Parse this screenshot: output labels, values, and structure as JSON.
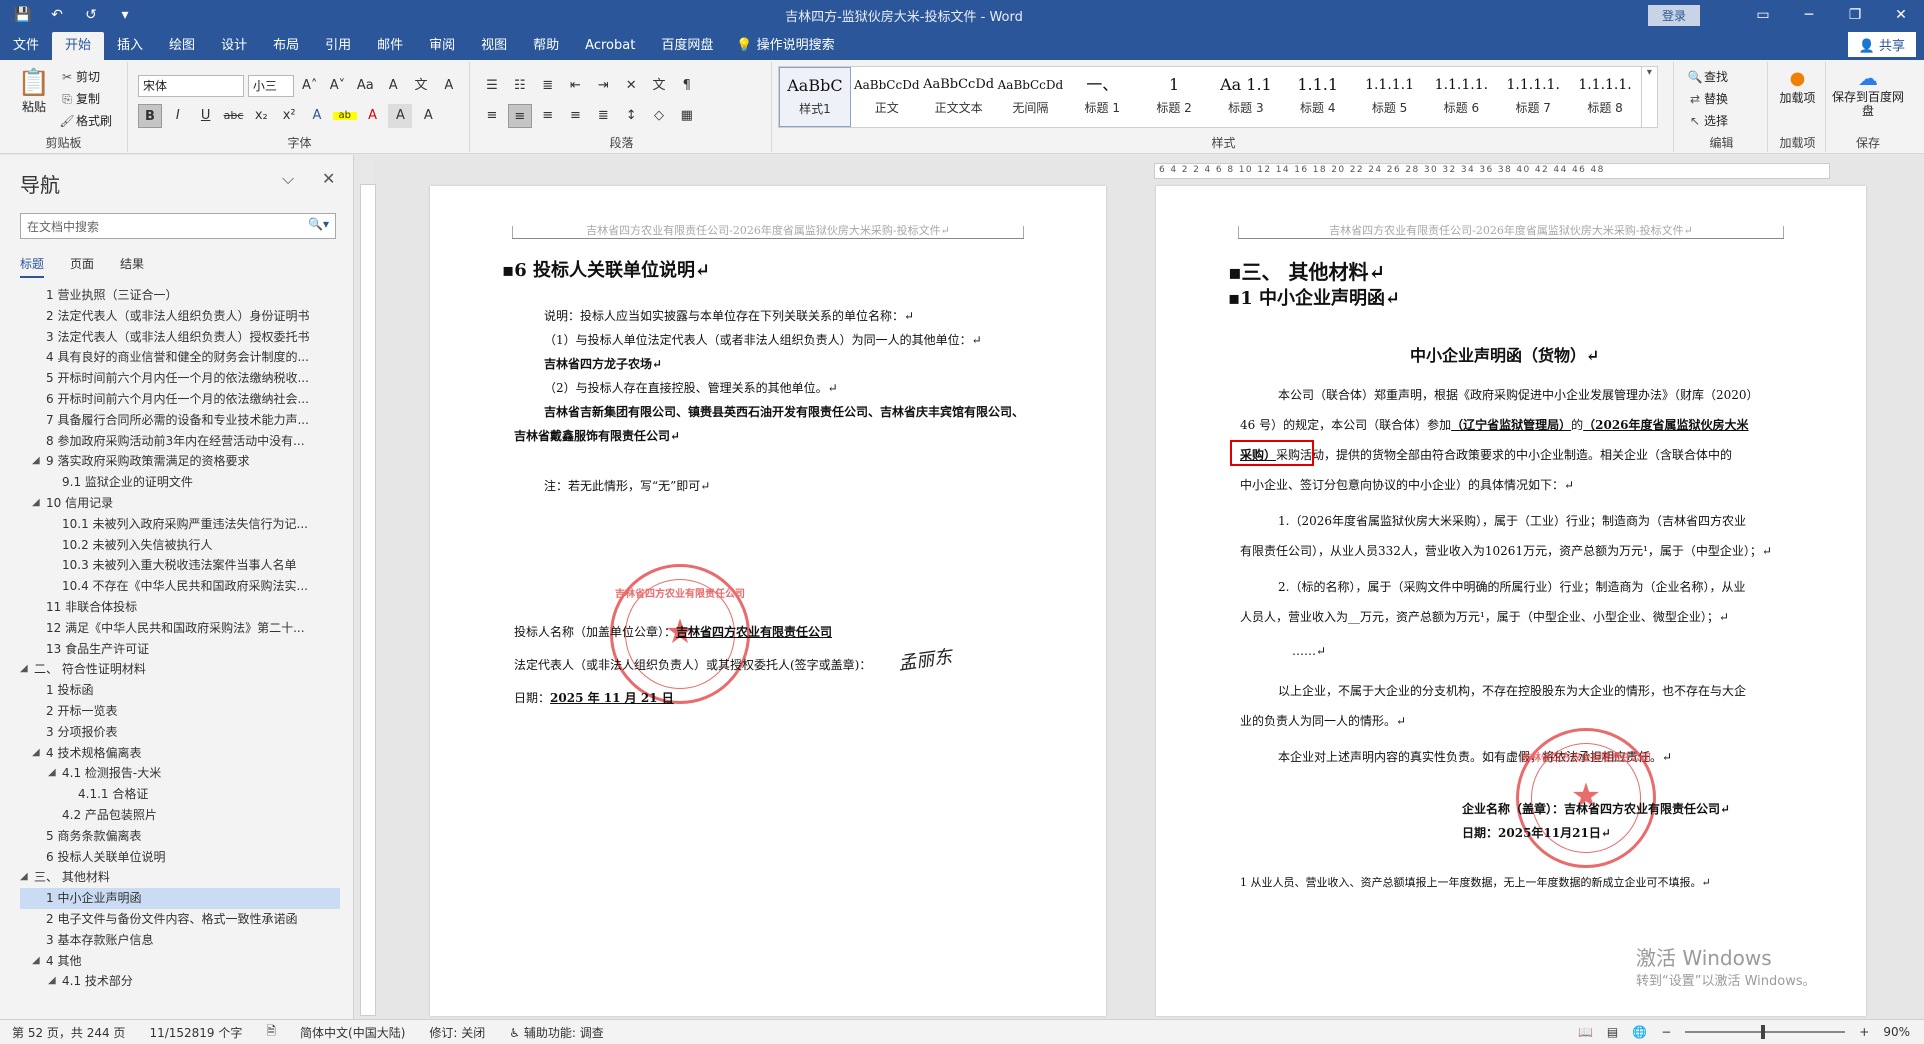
{
  "titlebar": {
    "title": "吉林四方-监狱伙房大米-投标文件 - Word",
    "login": "登录",
    "qa": [
      "💾",
      "↶",
      "↺",
      "▾"
    ],
    "winctl": [
      "▭",
      "─",
      "❐",
      "✕"
    ]
  },
  "tabs": [
    "文件",
    "开始",
    "插入",
    "绘图",
    "设计",
    "布局",
    "引用",
    "邮件",
    "审阅",
    "视图",
    "帮助",
    "Acrobat",
    "百度网盘"
  ],
  "active_tab": "开始",
  "tellme": "操作说明搜索",
  "share": "共享",
  "ribbon": {
    "clipboard": {
      "paste": "粘贴",
      "cut": "剪切",
      "copy": "复制",
      "format_painter": "格式刷",
      "label": "剪贴板"
    },
    "font": {
      "name": "宋体",
      "size": "小三",
      "label": "字体",
      "btns1": [
        "A˄",
        "A˅",
        "Aa",
        "A",
        "文",
        "A"
      ],
      "btns2": [
        "B",
        "I",
        "U",
        "abc",
        "x₂",
        "x²",
        "A",
        "ab",
        "A",
        "A",
        "A"
      ]
    },
    "paragraph": {
      "label": "段落",
      "btns1": [
        "☰",
        "☷",
        "≣",
        "⇤",
        "⇥",
        "✕",
        "文",
        "¶"
      ],
      "btns2": [
        "≡",
        "≡",
        "≡",
        "≡",
        "≣",
        "↕",
        "◇",
        "▦"
      ]
    },
    "styles": {
      "label": "样式",
      "items": [
        {
          "preview": "AaBbC",
          "name": "样式1"
        },
        {
          "preview": "AaBbCcDd",
          "name": "正文"
        },
        {
          "preview": "AaBbCcDd",
          "name": "正文文本"
        },
        {
          "preview": "AaBbCcDd",
          "name": "无间隔"
        },
        {
          "preview": "一、",
          "name": "标题 1"
        },
        {
          "preview": "1",
          "name": "标题 2"
        },
        {
          "preview": "Aa 1.1",
          "name": "标题 3"
        },
        {
          "preview": "1.1.1",
          "name": "标题 4"
        },
        {
          "preview": "1.1.1.1",
          "name": "标题 5"
        },
        {
          "preview": "1.1.1.1.",
          "name": "标题 6"
        },
        {
          "preview": "1.1.1.1.",
          "name": "标题 7"
        },
        {
          "preview": "1.1.1.1.",
          "name": "标题 8"
        }
      ]
    },
    "editing": {
      "find": "查找",
      "replace": "替换",
      "select": "选择",
      "label": "编辑"
    },
    "addins": {
      "name": "加载项",
      "label": "加载项"
    },
    "save": {
      "name": "保存到百度网盘",
      "label": "保存"
    }
  },
  "nav": {
    "title": "导航",
    "search_placeholder": "在文档中搜索",
    "tabs": [
      "标题",
      "页面",
      "结果"
    ],
    "items": [
      {
        "text": "1 营业执照（三证合一）",
        "level": 2
      },
      {
        "text": "2 法定代表人（或非法人组织负责人）身份证明书",
        "level": 2
      },
      {
        "text": "3 法定代表人（或非法人组织负责人）授权委托书",
        "level": 2
      },
      {
        "text": "4 具有良好的商业信誉和健全的财务会计制度的...",
        "level": 2
      },
      {
        "text": "5 开标时间前六个月内任一个月的依法缴纳税收...",
        "level": 2
      },
      {
        "text": "6 开标时间前六个月内任一个月的依法缴纳社会...",
        "level": 2
      },
      {
        "text": "7 具备履行合同所必需的设备和专业技术能力声...",
        "level": 2
      },
      {
        "text": "8 参加政府采购活动前3年内在经营活动中没有...",
        "level": 2
      },
      {
        "text": "9 落实政府采购政策需满足的资格要求",
        "level": 2,
        "toggle": "◢"
      },
      {
        "text": "9.1 监狱企业的证明文件",
        "level": 3
      },
      {
        "text": "10 信用记录",
        "level": 2,
        "toggle": "◢"
      },
      {
        "text": "10.1 未被列入政府采购严重违法失信行为记...",
        "level": 3
      },
      {
        "text": "10.2 未被列入失信被执行人",
        "level": 3
      },
      {
        "text": "10.3 未被列入重大税收违法案件当事人名单",
        "level": 3
      },
      {
        "text": "10.4 不存在《中华人民共和国政府采购法实...",
        "level": 3
      },
      {
        "text": "11 非联合体投标",
        "level": 2
      },
      {
        "text": "12 满足《中华人民共和国政府采购法》第二十...",
        "level": 2
      },
      {
        "text": "13 食品生产许可证",
        "level": 2
      },
      {
        "text": "二、 符合性证明材料",
        "level": 1,
        "toggle": "◢"
      },
      {
        "text": "1 投标函",
        "level": 2
      },
      {
        "text": "2 开标一览表",
        "level": 2
      },
      {
        "text": "3 分项报价表",
        "level": 2
      },
      {
        "text": "4 技术规格偏离表",
        "level": 2,
        "toggle": "◢"
      },
      {
        "text": "4.1 检测报告-大米",
        "level": 3,
        "toggle": "◢"
      },
      {
        "text": "4.1.1 合格证",
        "level": 4
      },
      {
        "text": "4.2 产品包装照片",
        "level": 3
      },
      {
        "text": "5 商务条款偏离表",
        "level": 2
      },
      {
        "text": "6 投标人关联单位说明",
        "level": 2
      },
      {
        "text": "三、 其他材料",
        "level": 1,
        "toggle": "◢"
      },
      {
        "text": "1 中小企业声明函",
        "level": 2,
        "selected": true
      },
      {
        "text": "2 电子文件与备份文件内容、格式一致性承诺函",
        "level": 2
      },
      {
        "text": "3 基本存款账户信息",
        "level": 2
      },
      {
        "text": "4 其他",
        "level": 2,
        "toggle": "◢"
      },
      {
        "text": "4.1 技术部分",
        "level": 3,
        "toggle": "◢"
      }
    ]
  },
  "ruler": {
    "ticks": "6  4  2  2  4  6  8  10  12  14  16  18  20  22  24  26  28  30  32  34  36  38  40  42  44  46  48"
  },
  "page1": {
    "header": "吉林省四方农业有限责任公司-2026年度省属监狱伙房大米采购-投标文件↵",
    "heading": "▪6 投标人关联单位说明↵",
    "lines": [
      "说明：投标人应当如实披露与本单位存在下列关联关系的单位名称：↵",
      "（1）与投标人单位法定代表人（或者非法人组织负责人）为同一人的其他单位：↵",
      "吉林省四方龙子农场↵",
      "（2）与投标人存在直接控股、管理关系的其他单位。↵",
      "吉林省吉新集团有限公司、镇赉县英西石油开发有限责任公司、吉林省庆丰宾馆有限公司、",
      "吉林省戴鑫服饰有限责任公司↵",
      "注：若无此情形，写“无”即可↵"
    ],
    "sign_name_label": "投标人名称（加盖单位公章）：",
    "sign_name_value": "吉林省四方农业有限责任公司",
    "legal_label": "法定代表人（或非法人组织负责人）或其授权委托人(签字或盖章)：",
    "date_label": "日期：",
    "date_value": "2025 年 11 月 21 日",
    "stamp_text": "吉林省四方农业有限责任公司",
    "signature": "孟丽东"
  },
  "page2": {
    "header": "吉林省四方农业有限责任公司-2026年度省属监狱伙房大米采购-投标文件↵",
    "h1": "▪三、 其他材料↵",
    "h2": "▪1 中小企业声明函↵",
    "title": "中小企业声明函（货物）↵",
    "p1a": "本公司（联合体）郑重声明，根据《政府采购促进中小企业发展管理办法》（财库（2020）",
    "p1b_pre": "46 号）的规定，本公司（联合体）参加",
    "p1b_u1": "（辽宁省监狱管理局）",
    "p1b_mid": "的",
    "p1b_u2": "（2026年度省属监狱伙房大米",
    "p1c_u": "采购）",
    "p1c_rest": "采购活动，提供的货物全部由符合政策要求的中小企业制造。相关企业（含联合体中的",
    "p1d": "中小企业、签订分包意向协议的中小企业）的具体情况如下：↵",
    "item1a": "1.（2026年度省属监狱伙房大米采购），属于（工业）行业；制造商为（吉林省四方农业",
    "item1b": "有限责任公司），从业人员332人，营业收入为10261万元，资产总额为万元¹，属于（中型企业）；↵",
    "item2a": "2.（标的名称），属于（采购文件中明确的所属行业）行业；制造商为（企业名称），从业",
    "item2b": "人员人，营业收入为__万元，资产总额为万元¹，属于（中型企业、小型企业、微型企业）；↵",
    "ellipsis": "……↵",
    "p2a": "以上企业，不属于大企业的分支机构，不存在控股股东为大企业的情形，也不存在与大企",
    "p2b": "业的负责人为同一人的情形。↵",
    "p3": "本企业对上述声明内容的真实性负责。如有虚假，将依法承担相应责任。↵",
    "company_label": "企业名称（盖章）：",
    "company_value": "吉林省四方农业有限责任公司↵",
    "date_label": "日期：",
    "date_value": "2025年11月21日↵",
    "footnote": "1 从业人员、营业收入、资产总额填报上一年度数据，无上一年度数据的新成立企业可不填报。↵",
    "stamp_text": "吉林省四方农业有限责任公司"
  },
  "watermark": {
    "line1": "激活 Windows",
    "line2": "转到“设置”以激活 Windows。"
  },
  "status": {
    "page": "第 52 页，共 244 页",
    "words": "11/152819 个字",
    "lang": "简体中文(中国大陆)",
    "track": "修订: 关闭",
    "access": "辅助功能: 调查",
    "zoom": "90%"
  },
  "colors": {
    "brand": "#2b579a",
    "stamp": "#e23a3a",
    "highlight_box": "#e00000"
  }
}
